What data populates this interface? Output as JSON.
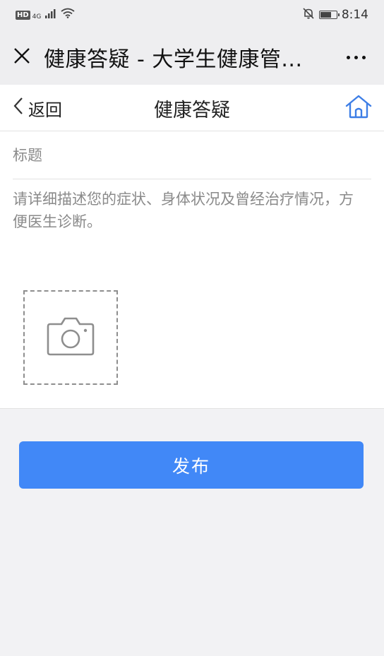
{
  "status_bar": {
    "hd": "HD",
    "network": "4G",
    "time": "8:14"
  },
  "wechat_bar": {
    "title": "健康答疑 - 大学生健康管..."
  },
  "header": {
    "back_label": "返回",
    "title": "健康答疑"
  },
  "form": {
    "title_placeholder": "标题",
    "description_placeholder": "请详细描述您的症状、身体状况及曾经治疗情况，方便医生诊断。"
  },
  "submit_label": "发布",
  "colors": {
    "accent": "#4188f7",
    "home_icon": "#3d7ee6"
  }
}
